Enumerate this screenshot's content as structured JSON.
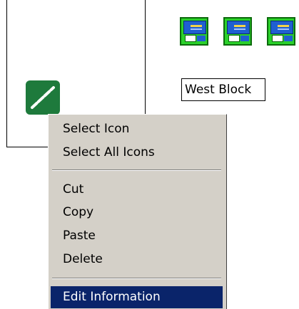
{
  "label": {
    "text": "West Block"
  },
  "menu": {
    "items": [
      {
        "label": "Select Icon"
      },
      {
        "label": "Select All Icons"
      },
      {
        "label": "Cut"
      },
      {
        "label": "Copy"
      },
      {
        "label": "Paste"
      },
      {
        "label": "Delete"
      },
      {
        "label": "Edit Information"
      }
    ],
    "selected": "Edit Information"
  },
  "colors": {
    "menu_bg": "#d4d0c8",
    "highlight": "#0a246a",
    "icon_green": "#2bd12b",
    "link_icon_green": "#1e7a3c"
  }
}
